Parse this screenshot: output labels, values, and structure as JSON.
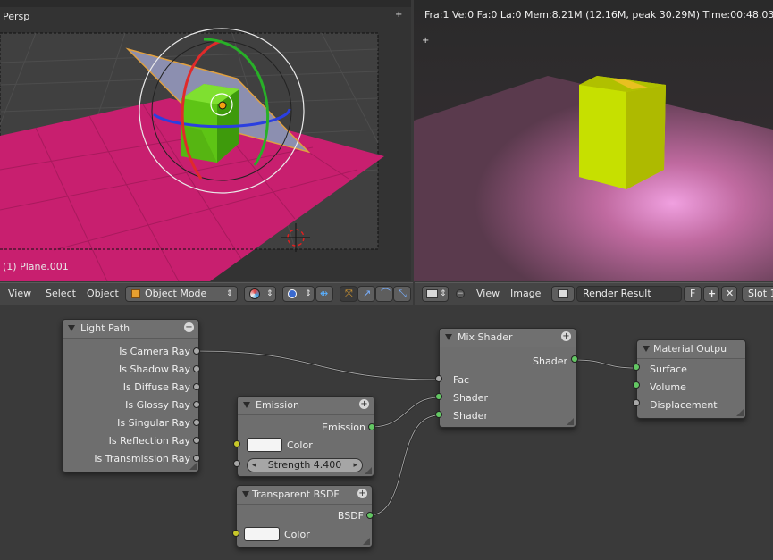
{
  "viewport3d": {
    "view_label": "Persp",
    "object_label": "(1) Plane.001"
  },
  "render_view": {
    "stats": "Fra:1  Ve:0 Fa:0 La:0 Mem:8.21M (12.16M, peak 30.29M) Time:00:48.03"
  },
  "header_left": {
    "menu": [
      "View",
      "Select",
      "Object"
    ],
    "mode": "Object Mode"
  },
  "header_right": {
    "menu": [
      "View",
      "Image"
    ],
    "image_name": "Render Result",
    "fake_user": "F",
    "slot": "Slot 1"
  },
  "nodes": {
    "light_path": {
      "title": "Light Path",
      "outputs": [
        "Is Camera Ray",
        "Is Shadow Ray",
        "Is Diffuse Ray",
        "Is Glossy Ray",
        "Is Singular Ray",
        "Is Reflection Ray",
        "Is Transmission Ray"
      ]
    },
    "emission": {
      "title": "Emission",
      "output": "Emission",
      "color_label": "Color",
      "strength": "Strength 4.400"
    },
    "transparent": {
      "title": "Transparent BSDF",
      "output": "BSDF",
      "color_label": "Color"
    },
    "mix_shader": {
      "title": "Mix Shader",
      "output": "Shader",
      "inputs": [
        "Fac",
        "Shader",
        "Shader"
      ]
    },
    "material_output": {
      "title": "Material Outpu",
      "inputs": [
        "Surface",
        "Volume",
        "Displacement"
      ]
    }
  },
  "colors": {
    "accent_pink": "#e0207a",
    "cube_green": "#66cc11",
    "socket_green": "#63c763",
    "socket_yellow": "#c7c729",
    "socket_gray": "#a8a8a8"
  }
}
